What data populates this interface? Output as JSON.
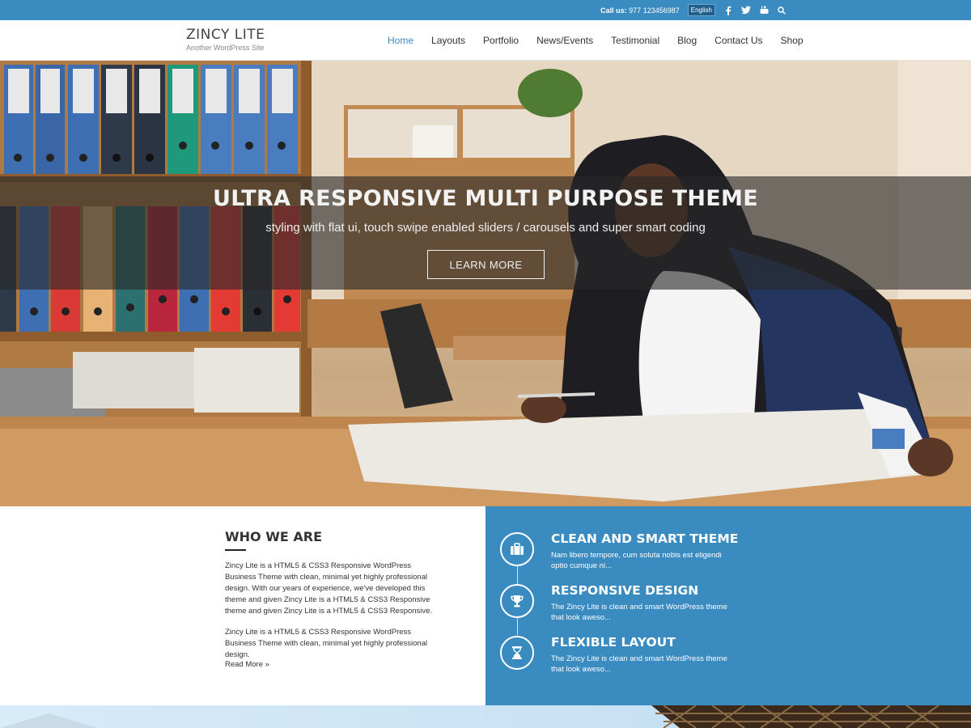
{
  "topbar": {
    "call_label": "Call us:",
    "phone": "977 123456987",
    "language": "English",
    "social": [
      "facebook-icon",
      "twitter-icon",
      "youtube-icon",
      "search-icon"
    ]
  },
  "header": {
    "site_title": "ZINCY LITE",
    "tagline": "Another WordPress Site",
    "nav": [
      "Home",
      "Layouts",
      "Portfolio",
      "News/Events",
      "Testimonial",
      "Blog",
      "Contact Us",
      "Shop"
    ],
    "active_nav": "Home"
  },
  "hero": {
    "title": "ULTRA RESPONSIVE MULTI PURPOSE THEME",
    "subtitle": "styling with flat ui, touch swipe enabled sliders / carousels and super smart coding",
    "button": "LEARN MORE"
  },
  "who": {
    "title": "WHO WE ARE",
    "paragraph1": "Zincy Lite is a HTML5 & CSS3 Responsive WordPress Business Theme with clean, minimal yet highly professional design. With our years of experience, we've developed this theme and given Zincy Lite is a HTML5 & CSS3 Responsive theme and given Zincy Lite is a HTML5 & CSS3 Responsive.",
    "paragraph2": "Zincy Lite is a HTML5 & CSS3 Responsive WordPress Business Theme with clean, minimal yet highly professional design.",
    "read_more": "Read More »"
  },
  "features": [
    {
      "icon": "briefcase-icon",
      "title": "CLEAN AND SMART THEME",
      "desc": "Nam libero tempore, cum soluta nobis est eligendi optio cumque ni..."
    },
    {
      "icon": "trophy-icon",
      "title": "RESPONSIVE DESIGN",
      "desc": "The Zincy Lite is clean and smart WordPress theme that look aweso..."
    },
    {
      "icon": "hourglass-icon",
      "title": "FLEXIBLE LAYOUT",
      "desc": "The Zincy Lite is clean and smart WordPress theme that look aweso..."
    }
  ],
  "colors": {
    "brand_blue": "#3a8bc0",
    "hero_overlay": "#282828",
    "text_dark": "#333333"
  }
}
